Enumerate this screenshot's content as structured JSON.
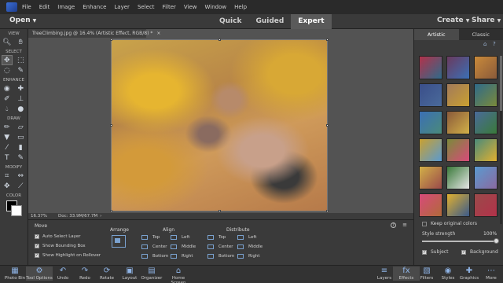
{
  "menubar": {
    "items": [
      "File",
      "Edit",
      "Image",
      "Enhance",
      "Layer",
      "Select",
      "Filter",
      "View",
      "Window",
      "Help"
    ]
  },
  "topbar": {
    "open_label": "Open",
    "modes": [
      "Quick",
      "Guided",
      "Expert"
    ],
    "active_mode": "Expert",
    "create_label": "Create",
    "share_label": "Share"
  },
  "toolbox": {
    "sections": [
      "VIEW",
      "SELECT",
      "ENHANCE",
      "DRAW",
      "MODIFY",
      "COLOR"
    ]
  },
  "document": {
    "tab_title": "TreeClimbing.jpg @ 16.4% (Artistic Effect, RGB/8) *",
    "zoom": "16.37%",
    "doc_size": "Doc: 33.9M/67.7M"
  },
  "options": {
    "move_title": "Move",
    "auto_select": "Auto Select Layer",
    "show_bbox": "Show Bounding Box",
    "show_highlight": "Show Highlight on Rollover",
    "arrange_title": "Arrange",
    "align_title": "Align",
    "align_items": [
      "Top",
      "Center",
      "Bottom",
      "Left",
      "Middle",
      "Right"
    ],
    "distribute_title": "Distribute",
    "distribute_items": [
      "Top",
      "Center",
      "Bottom",
      "Left",
      "Middle",
      "Right"
    ]
  },
  "effects_panel": {
    "tabs": [
      "Artistic",
      "Classic"
    ],
    "active_tab": "Artistic",
    "keep_original": "Keep original colors",
    "style_strength_label": "Style strength",
    "style_strength_value": "100%",
    "style_strength_fraction": 1.0,
    "subject_label": "Subject",
    "background_label": "Background",
    "thumb_colors": [
      "#b2324a",
      "#6a3a5e",
      "#c98a3a",
      "#3a4e8a",
      "#a27a5a",
      "#2f6a8a",
      "#3b6fb5",
      "#8a5a3a",
      "#4a6a9a",
      "#c9a030",
      "#7a8a3a",
      "#4a8a7a",
      "#d2b048",
      "#3a7a3a",
      "#5a9ad0",
      "#d84a7a",
      "#e0b030",
      "#9a4a4a",
      "#e6e6e6",
      "#8a6aa0",
      "#b06a3a",
      "#3a5a8a"
    ]
  },
  "taskbar": {
    "left": [
      {
        "label": "Photo Bin",
        "icon": "photo-bin-icon",
        "glyph": "▦"
      },
      {
        "label": "Tool Options",
        "icon": "tool-options-icon",
        "glyph": "⚙"
      },
      {
        "label": "Undo",
        "icon": "undo-icon",
        "glyph": "↶"
      },
      {
        "label": "Redo",
        "icon": "redo-icon",
        "glyph": "↷"
      },
      {
        "label": "Rotate",
        "icon": "rotate-icon",
        "glyph": "⟳"
      },
      {
        "label": "Layout",
        "icon": "layout-icon",
        "glyph": "▣"
      },
      {
        "label": "Organizer",
        "icon": "organizer-icon",
        "glyph": "▤"
      },
      {
        "label": "Home Screen",
        "icon": "home-icon",
        "glyph": "⌂"
      }
    ],
    "right": [
      {
        "label": "Layers",
        "icon": "layers-icon",
        "glyph": "≡"
      },
      {
        "label": "Effects",
        "icon": "effects-icon",
        "glyph": "fx"
      },
      {
        "label": "Filters",
        "icon": "filters-icon",
        "glyph": "▧"
      },
      {
        "label": "Styles",
        "icon": "styles-icon",
        "glyph": "◉"
      },
      {
        "label": "Graphics",
        "icon": "graphics-icon",
        "glyph": "✚"
      },
      {
        "label": "More",
        "icon": "more-icon",
        "glyph": "⋯"
      }
    ]
  }
}
